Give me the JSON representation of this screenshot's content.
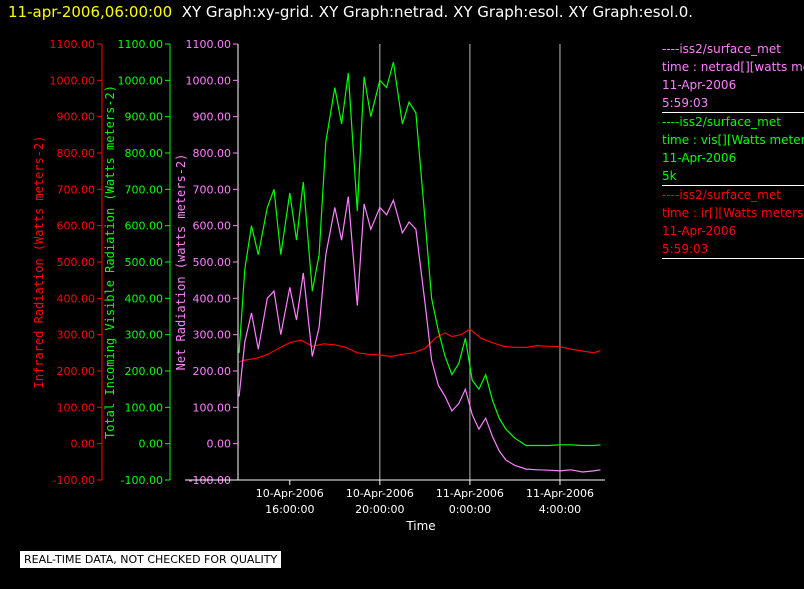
{
  "title": {
    "timestamp": "11-apr-2006,06:00:00",
    "rest": "XY Graph:xy-grid.  XY Graph:netrad.  XY Graph:esol.  XY Graph:esol.0."
  },
  "notice": "REAL-TIME DATA, NOT CHECKED FOR QUALITY",
  "legend": [
    {
      "color": "#ff80ff",
      "lines": [
        "----iss2/surface_met",
        "time : netrad[][watts me",
        "11-Apr-2006",
        "5:59:03"
      ]
    },
    {
      "color": "#00ff00",
      "lines": [
        "----iss2/surface_met",
        "time : vis[][Watts meter",
        "11-Apr-2006",
        "5k"
      ]
    },
    {
      "color": "#ff0000",
      "lines": [
        "----iss2/surface_met",
        "time : ir[][Watts meters",
        "11-Apr-2006",
        "5:59:03"
      ]
    }
  ],
  "colors": {
    "ir": "#ff0000",
    "vis": "#00ff00",
    "net": "#ff80ff",
    "frame": "#ffffff",
    "grid": "#bbbbbb"
  },
  "chart_data": {
    "type": "line",
    "xlabel": "Time",
    "x_ticks": [
      {
        "x": 16,
        "label": [
          "10-Apr-2006",
          "16:00:00"
        ]
      },
      {
        "x": 20,
        "label": [
          "10-Apr-2006",
          "20:00:00"
        ]
      },
      {
        "x": 24,
        "label": [
          "11-Apr-2006",
          "0:00:00"
        ]
      },
      {
        "x": 28,
        "label": [
          "11-Apr-2006",
          "4:00:00"
        ]
      }
    ],
    "xlim": [
      13.7,
      30.0
    ],
    "ylim": [
      -100,
      1100
    ],
    "y_ticks": [
      "-100.00",
      "0.00",
      "100.00",
      "200.00",
      "300.00",
      "400.00",
      "500.00",
      "600.00",
      "700.00",
      "800.00",
      "900.00",
      "1000.00",
      "1100.00"
    ],
    "grid": "vertical",
    "y_axes": [
      {
        "label": "Infrared Radiation (Watts meters-2)",
        "color": "#ff0000"
      },
      {
        "label": "Total Incoming Visible Radiation (Watts meters-2)",
        "color": "#00ff00"
      },
      {
        "label": "Net Radiation (watts meters-2)",
        "color": "#ff80ff"
      }
    ],
    "series": [
      {
        "name": "ir",
        "x": [
          13.75,
          14.0,
          14.5,
          15.0,
          15.5,
          16.0,
          16.5,
          17.0,
          17.5,
          18.0,
          18.5,
          19.0,
          19.5,
          20.0,
          20.5,
          21.0,
          21.5,
          22.0,
          22.5,
          22.9,
          23.2,
          23.6,
          24.0,
          24.5,
          25.0,
          25.5,
          26.0,
          26.5,
          27.0,
          27.5,
          28.0,
          28.5,
          29.0,
          29.5,
          29.8
        ],
        "y": [
          225,
          230,
          235,
          245,
          262,
          278,
          285,
          268,
          275,
          272,
          265,
          250,
          246,
          244,
          240,
          246,
          250,
          262,
          292,
          305,
          295,
          300,
          315,
          290,
          278,
          268,
          265,
          265,
          270,
          268,
          267,
          260,
          255,
          250,
          256
        ]
      },
      {
        "name": "vis",
        "x": [
          13.75,
          14.0,
          14.3,
          14.6,
          15.0,
          15.3,
          15.6,
          16.0,
          16.3,
          16.6,
          17.0,
          17.3,
          17.6,
          18.0,
          18.3,
          18.6,
          19.0,
          19.3,
          19.6,
          20.0,
          20.3,
          20.6,
          21.0,
          21.3,
          21.6,
          22.0,
          22.3,
          22.6,
          22.9,
          23.2,
          23.5,
          23.8,
          24.1,
          24.4,
          24.7,
          25.0,
          25.3,
          25.6,
          26.0,
          26.5,
          27.0,
          27.5,
          28.0,
          28.5,
          29.0,
          29.5,
          29.8
        ],
        "y": [
          250,
          480,
          600,
          520,
          650,
          700,
          520,
          690,
          560,
          720,
          420,
          520,
          830,
          980,
          880,
          1020,
          640,
          1010,
          900,
          1000,
          980,
          1050,
          880,
          940,
          910,
          620,
          400,
          310,
          240,
          190,
          220,
          290,
          175,
          150,
          190,
          120,
          70,
          40,
          15,
          -5,
          -5,
          -5,
          -3,
          -3,
          -5,
          -5,
          -3
        ]
      },
      {
        "name": "net",
        "x": [
          13.75,
          14.0,
          14.3,
          14.6,
          15.0,
          15.3,
          15.6,
          16.0,
          16.3,
          16.6,
          17.0,
          17.3,
          17.6,
          18.0,
          18.3,
          18.6,
          19.0,
          19.3,
          19.6,
          20.0,
          20.3,
          20.6,
          21.0,
          21.3,
          21.6,
          22.0,
          22.3,
          22.6,
          22.9,
          23.2,
          23.5,
          23.8,
          24.1,
          24.4,
          24.7,
          25.0,
          25.3,
          25.6,
          26.0,
          26.5,
          27.0,
          27.5,
          28.0,
          28.5,
          29.0,
          29.5,
          29.8
        ],
        "y": [
          130,
          280,
          360,
          260,
          400,
          420,
          300,
          430,
          340,
          470,
          240,
          320,
          520,
          650,
          560,
          680,
          380,
          660,
          590,
          650,
          630,
          670,
          580,
          610,
          590,
          390,
          230,
          160,
          130,
          90,
          110,
          150,
          80,
          40,
          70,
          20,
          -20,
          -45,
          -60,
          -70,
          -72,
          -73,
          -75,
          -72,
          -78,
          -75,
          -72
        ]
      }
    ]
  }
}
